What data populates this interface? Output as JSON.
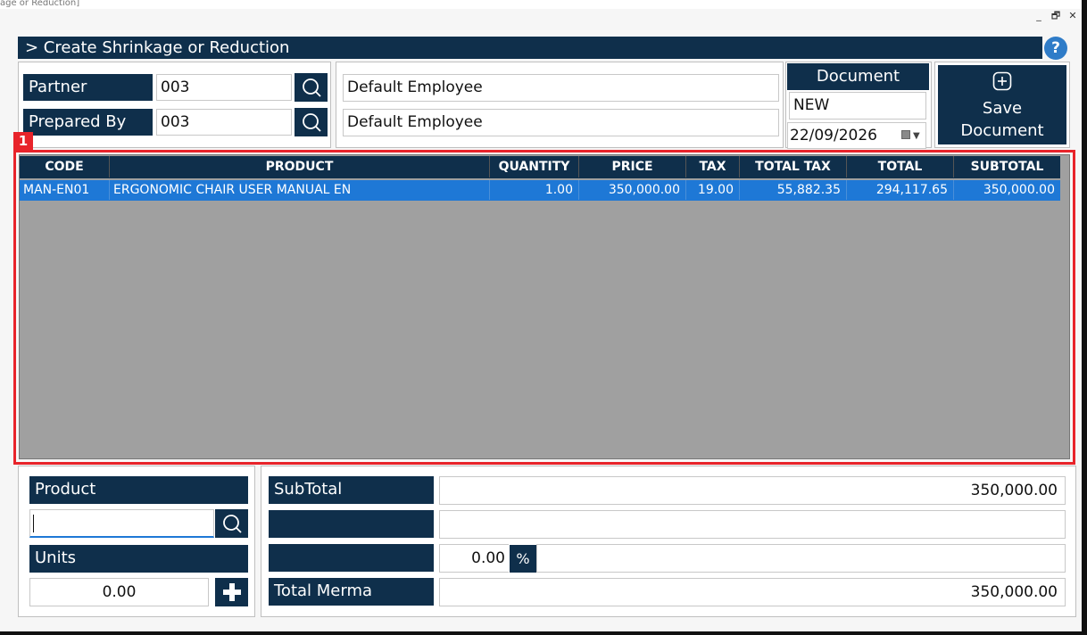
{
  "window": {
    "caption": "age or Reduction]",
    "controls": {
      "minimize": "_",
      "restore": "🗗",
      "close": "✕"
    }
  },
  "header": {
    "title": "> Create Shrinkage or Reduction",
    "help": "?"
  },
  "form": {
    "partner_label": "Partner",
    "partner_value": "003",
    "prepared_label": "Prepared By",
    "prepared_value": "003",
    "partner_name": "Default Employee",
    "prepared_name": "Default Employee"
  },
  "document": {
    "label": "Document",
    "number": "NEW",
    "date": "22/09/2026"
  },
  "save_button": {
    "line1": "Save",
    "line2": "Document"
  },
  "annotation": {
    "marker": "1"
  },
  "grid": {
    "columns": [
      "CODE",
      "PRODUCT",
      "QUANTITY",
      "PRICE",
      "TAX",
      "TOTAL TAX",
      "TOTAL",
      "SUBTOTAL"
    ],
    "rows": [
      [
        "MAN-EN01",
        "ERGONOMIC CHAIR USER MANUAL EN",
        "1.00",
        "350,000.00",
        "19.00",
        "55,882.35",
        "294,117.65",
        "350,000.00"
      ]
    ]
  },
  "entry": {
    "product_label": "Product",
    "product_value": "",
    "units_label": "Units",
    "units_value": "0.00"
  },
  "totals": {
    "subtotal_label": "SubTotal",
    "subtotal_value": "350,000.00",
    "row2_label": "",
    "row2_value": "",
    "discount_value": "0.00",
    "discount_symbol": "%",
    "discount_extra": "",
    "total_label": "Total Merma",
    "total_value": "350,000.00"
  },
  "colors": {
    "navy": "#0f2f4b",
    "selection": "#1e78d6",
    "grid_bg": "#a0a0a0",
    "annotation": "#e8232a",
    "help": "#2f7cc8"
  }
}
